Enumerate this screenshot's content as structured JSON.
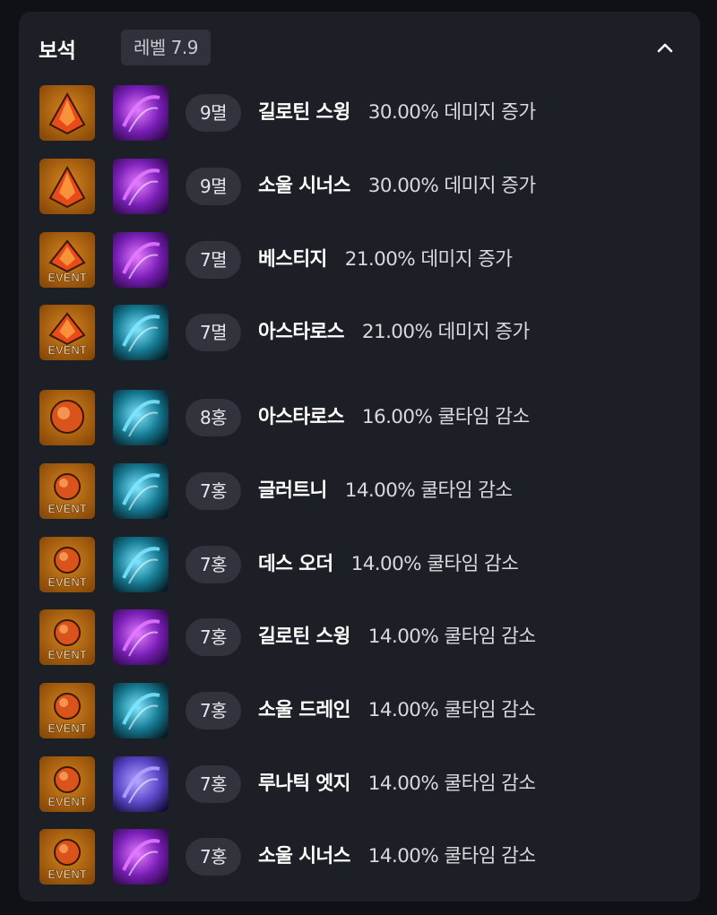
{
  "header": {
    "title": "보석",
    "level_label": "레벨 7.9"
  },
  "colors": {
    "page_background": "#101116",
    "panel_background": "#1d1f26",
    "pill_background": "#31343d",
    "gem_frame": "#b66a10",
    "damage_gem_core": "#e84a1a",
    "cooldown_gem_core": "#d9531a"
  },
  "gems": [
    {
      "gem_icon": "damage-gem-icon",
      "event": false,
      "skill_icon": "guillotine-swing-skill-icon",
      "skill_color": "violet",
      "level": "9멸",
      "skill": "길로틴 스윙",
      "effect": "30.00% 데미지 증가"
    },
    {
      "gem_icon": "damage-gem-icon",
      "event": false,
      "skill_icon": "soul-synergy-skill-icon",
      "skill_color": "violet",
      "level": "9멸",
      "skill": "소울 시너스",
      "effect": "30.00% 데미지 증가"
    },
    {
      "gem_icon": "event-damage-gem-icon",
      "event": true,
      "skill_icon": "vestige-skill-icon",
      "skill_color": "violet",
      "level": "7멸",
      "skill": "베스티지",
      "effect": "21.00% 데미지 증가"
    },
    {
      "gem_icon": "event-damage-gem-icon",
      "event": true,
      "skill_icon": "astaros-skill-icon",
      "skill_color": "teal",
      "level": "7멸",
      "skill": "아스타로스",
      "effect": "21.00% 데미지 증가"
    },
    {
      "gem_icon": "cooldown-gem-icon",
      "event": false,
      "skill_icon": "astaros-skill-icon",
      "skill_color": "teal",
      "level": "8홍",
      "skill": "아스타로스",
      "effect": "16.00% 쿨타임 감소"
    },
    {
      "gem_icon": "event-cooldown-gem-icon",
      "event": true,
      "skill_icon": "gluttony-skill-icon",
      "skill_color": "teal",
      "level": "7홍",
      "skill": "글러트니",
      "effect": "14.00% 쿨타임 감소"
    },
    {
      "gem_icon": "event-cooldown-gem-icon",
      "event": true,
      "skill_icon": "death-order-skill-icon",
      "skill_color": "teal",
      "level": "7홍",
      "skill": "데스 오더",
      "effect": "14.00% 쿨타임 감소"
    },
    {
      "gem_icon": "event-cooldown-gem-icon",
      "event": true,
      "skill_icon": "guillotine-swing-skill-icon",
      "skill_color": "violet",
      "level": "7홍",
      "skill": "길로틴 스윙",
      "effect": "14.00% 쿨타임 감소"
    },
    {
      "gem_icon": "event-cooldown-gem-icon",
      "event": true,
      "skill_icon": "soul-drain-skill-icon",
      "skill_color": "teal",
      "level": "7홍",
      "skill": "소울 드레인",
      "effect": "14.00% 쿨타임 감소"
    },
    {
      "gem_icon": "event-cooldown-gem-icon",
      "event": true,
      "skill_icon": "lunatic-edge-skill-icon",
      "skill_color": "indigo",
      "level": "7홍",
      "skill": "루나틱 엣지",
      "effect": "14.00% 쿨타임 감소"
    },
    {
      "gem_icon": "event-cooldown-gem-icon",
      "event": true,
      "skill_icon": "soul-synergy-skill-icon",
      "skill_color": "violet",
      "level": "7홍",
      "skill": "소울 시너스",
      "effect": "14.00% 쿨타임 감소"
    }
  ],
  "event_badge_text": "EVENT"
}
